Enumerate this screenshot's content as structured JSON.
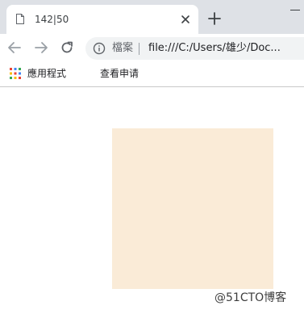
{
  "tab": {
    "title": "142|50",
    "icon": "document-icon"
  },
  "toolbar": {
    "site_label": "檔案",
    "url": "file:///C:/Users/雄少/Doc..."
  },
  "bookmarks": {
    "apps_label": "應用程式",
    "items": [
      "查看申请"
    ]
  },
  "content": {
    "box_color": "#faebd7"
  },
  "watermark": "@51CTO博客"
}
